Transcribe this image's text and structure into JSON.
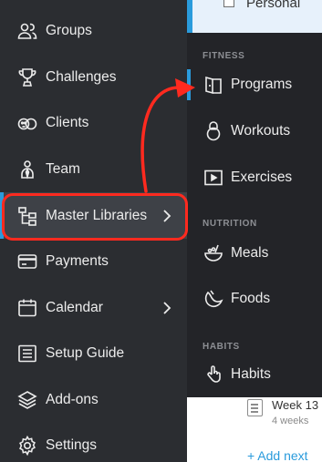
{
  "sidebar": {
    "items": [
      {
        "id": "groups",
        "label": "Groups",
        "icon": "groups-icon"
      },
      {
        "id": "challenges",
        "label": "Challenges",
        "icon": "trophy-icon"
      },
      {
        "id": "clients",
        "label": "Clients",
        "icon": "clients-icon"
      },
      {
        "id": "team",
        "label": "Team",
        "icon": "team-icon"
      },
      {
        "id": "master-libraries",
        "label": "Master Libraries",
        "icon": "hierarchy-icon",
        "has_submenu": true,
        "active": true
      },
      {
        "id": "payments",
        "label": "Payments",
        "icon": "credit-card-icon"
      },
      {
        "id": "calendar",
        "label": "Calendar",
        "icon": "calendar-icon",
        "has_submenu": true
      },
      {
        "id": "setup-guide",
        "label": "Setup Guide",
        "icon": "checklist-icon"
      },
      {
        "id": "add-ons",
        "label": "Add-ons",
        "icon": "layers-icon"
      },
      {
        "id": "settings",
        "label": "Settings",
        "icon": "gear-icon"
      }
    ]
  },
  "submenu": {
    "sections": [
      {
        "header": "FITNESS",
        "items": [
          {
            "label": "Programs",
            "icon": "book-icon",
            "current": true
          },
          {
            "label": "Workouts",
            "icon": "kettlebell-icon"
          },
          {
            "label": "Exercises",
            "icon": "play-icon"
          }
        ]
      },
      {
        "header": "NUTRITION",
        "items": [
          {
            "label": "Meals",
            "icon": "bowl-icon"
          },
          {
            "label": "Foods",
            "icon": "fruit-icon"
          }
        ]
      },
      {
        "header": "HABITS",
        "items": [
          {
            "label": "Habits",
            "icon": "hand-icon"
          }
        ]
      }
    ]
  },
  "background": {
    "top_item": "Personal",
    "week_title": "Week 13",
    "week_subtitle": "4 weeks",
    "add_next": "+ Add next"
  },
  "colors": {
    "sidebar_bg": "#2b2d31",
    "submenu_bg": "#232428",
    "accent": "#2a9bdc",
    "annotation": "#ff2a1f",
    "text": "#ececec"
  }
}
